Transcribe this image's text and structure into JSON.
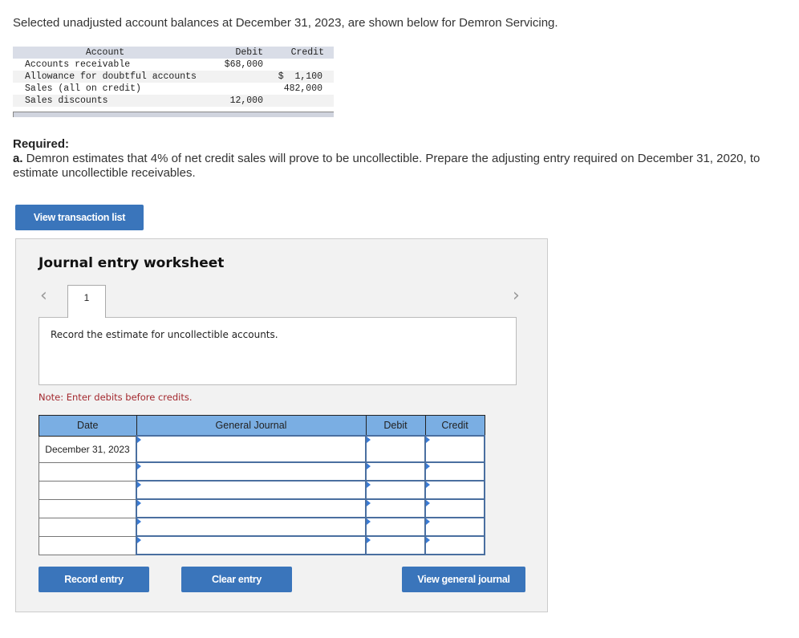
{
  "intro_text": "Selected unadjusted account balances at December 31, 2023, are shown below for Demron Servicing.",
  "balances": {
    "headers": {
      "account": "Account",
      "debit": "Debit",
      "credit": "Credit"
    },
    "rows": [
      {
        "account": "Accounts receivable",
        "debit": "$68,000",
        "credit": ""
      },
      {
        "account": "Allowance for doubtful accounts",
        "debit": "",
        "credit": "$  1,100"
      },
      {
        "account": "Sales (all on credit)",
        "debit": "",
        "credit": "482,000"
      },
      {
        "account": "Sales discounts",
        "debit": "12,000",
        "credit": ""
      }
    ]
  },
  "required": {
    "label": "Required:",
    "part_label": "a.",
    "text": " Demron estimates that 4% of net credit sales will prove to be uncollectible. Prepare the adjusting entry required on December 31, 2020, to estimate uncollectible receivables."
  },
  "buttons": {
    "view_transaction_list": "View transaction list",
    "record_entry": "Record entry",
    "clear_entry": "Clear entry",
    "view_general_journal": "View general journal"
  },
  "worksheet": {
    "title": "Journal entry worksheet",
    "prev_icon": "‹",
    "next_icon": "›",
    "tab_label": "1",
    "description": "Record the estimate for uncollectible accounts.",
    "note": "Note: Enter debits before credits.",
    "table": {
      "headers": {
        "date": "Date",
        "general_journal": "General Journal",
        "debit": "Debit",
        "credit": "Credit"
      },
      "rows": [
        {
          "date": "December 31, 2023",
          "account": "",
          "debit": "",
          "credit": ""
        },
        {
          "date": "",
          "account": "",
          "debit": "",
          "credit": ""
        },
        {
          "date": "",
          "account": "",
          "debit": "",
          "credit": ""
        },
        {
          "date": "",
          "account": "",
          "debit": "",
          "credit": ""
        },
        {
          "date": "",
          "account": "",
          "debit": "",
          "credit": ""
        },
        {
          "date": "",
          "account": "",
          "debit": "",
          "credit": ""
        }
      ]
    }
  }
}
